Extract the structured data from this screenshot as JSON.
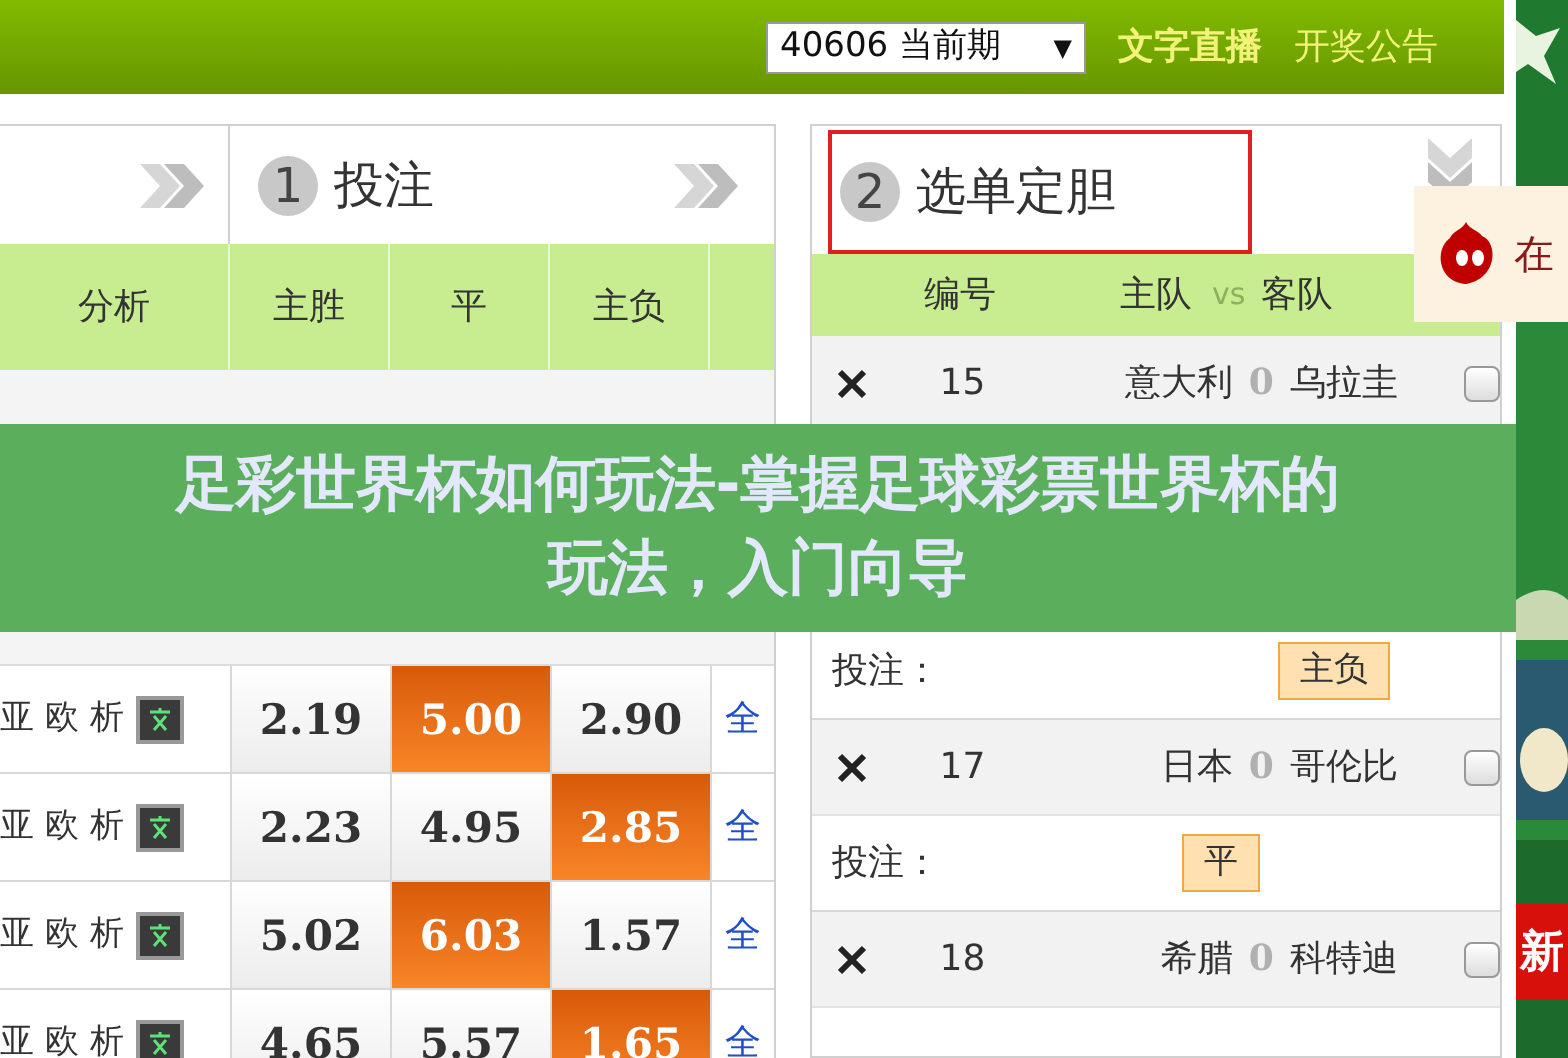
{
  "top_bar": {
    "period_select": "40606 当前期",
    "select_arrow": "▼",
    "links": [
      {
        "label": "文字直播",
        "selected": true
      },
      {
        "label": "开奖公告",
        "selected": false
      }
    ]
  },
  "bet_panel": {
    "step": {
      "number": "1",
      "label": "投注"
    },
    "columns": [
      "分析",
      "主胜",
      "平",
      "主负"
    ],
    "rows": [
      {
        "analysis": "亚 欧 析",
        "text_icon": true,
        "odds": [
          {
            "value": "2.19",
            "selected": false
          },
          {
            "value": "5.00",
            "selected": true
          },
          {
            "value": "2.90",
            "selected": false
          }
        ],
        "all": "全"
      },
      {
        "analysis": "亚 欧 析",
        "text_icon": true,
        "odds": [
          {
            "value": "2.23",
            "selected": false
          },
          {
            "value": "4.95",
            "selected": false
          },
          {
            "value": "2.85",
            "selected": true
          }
        ],
        "all": "全"
      },
      {
        "analysis": "亚 欧 析",
        "text_icon": true,
        "odds": [
          {
            "value": "5.02",
            "selected": false
          },
          {
            "value": "6.03",
            "selected": true
          },
          {
            "value": "1.57",
            "selected": false
          }
        ],
        "all": "全"
      },
      {
        "analysis": "亚 欧 析",
        "text_icon": true,
        "odds": [
          {
            "value": "4.65",
            "selected": false
          },
          {
            "value": "5.57",
            "selected": false
          },
          {
            "value": "1.65",
            "selected": true
          }
        ],
        "all": "全"
      }
    ]
  },
  "pick_panel": {
    "step": {
      "number": "2",
      "label": "选单定胆"
    },
    "columns": [
      "编号",
      "主队",
      "vs",
      "客队"
    ],
    "matches": [
      {
        "number": "15",
        "home": "意大利",
        "handicap": "0",
        "color": "#b0b0b0",
        "away": "乌拉圭",
        "banker": false
      },
      {
        "bet_label": "投注：",
        "pick": "主负"
      },
      {
        "number": "17",
        "home": "日本",
        "handicap": "0",
        "color": "#b0b0b0",
        "away": "哥伦比",
        "banker": false,
        "bet_label": "投注：",
        "pick": "平"
      },
      {
        "number": "18",
        "home": "希腊",
        "handicap": "0",
        "color": "#b0b0b0",
        "away": "科特迪",
        "banker": false
      }
    ]
  },
  "popup": {
    "text": "在"
  },
  "ad": {
    "kind": "picture",
    "badge": "新"
  },
  "banner": {
    "title_lines": [
      "足彩世界杯如何玩法-掌握足球彩票世界杯的",
      "玩法，入门向导"
    ]
  }
}
